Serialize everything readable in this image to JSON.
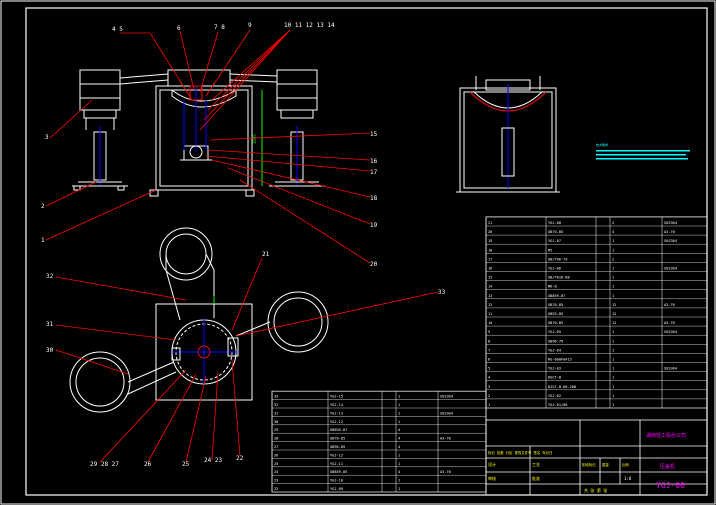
{
  "balloons": {
    "b1": "1",
    "b2": "2",
    "b3": "3",
    "b45": "4 5",
    "b6": "6",
    "b78": "7 8",
    "b9": "9",
    "b10_14": "10 11 12 13 14",
    "b15": "15",
    "b16": "16",
    "b17": "17",
    "b18": "18",
    "b19": "19",
    "b20": "20",
    "b21": "21",
    "b22": "22",
    "b2423": "24 23",
    "b25": "25",
    "b26": "26",
    "b272829": "29 28 27",
    "b30": "30",
    "b31": "31",
    "b32": "32",
    "b33": "33"
  },
  "company": "湖南轻工股份公司",
  "drawing_name": "压盖机",
  "drawing_no": "YGJ-00",
  "bom_right": [
    [
      "21",
      "YGJ-08",
      "",
      "2",
      "SUS304"
    ],
    [
      "20",
      "GB70-85",
      "",
      "4",
      "A3-70"
    ],
    [
      "19",
      "YGJ-07",
      "",
      "1",
      "SUS304"
    ],
    [
      "18",
      "M5",
      "",
      "1",
      ""
    ],
    [
      "17",
      "GB/T96-79",
      "",
      "2",
      ""
    ],
    [
      "16",
      "YGJ-06",
      "",
      "1",
      "SUS304"
    ],
    [
      "15",
      "GB/T816-88",
      "",
      "1",
      ""
    ],
    [
      "14",
      "M6-8",
      "",
      "1",
      ""
    ],
    [
      "13",
      "GB859-87",
      "",
      "1",
      ""
    ],
    [
      "12",
      "GB70-85",
      "",
      "12",
      "A3-70"
    ],
    [
      "11",
      "GB93-85",
      "",
      "12",
      ""
    ],
    [
      "10",
      "GB70-85",
      "",
      "12",
      "A3-70"
    ],
    [
      "9",
      "YGJ-05",
      "",
      "1",
      "SUS304"
    ],
    [
      "8",
      "GB96-79",
      "",
      "1",
      ""
    ],
    [
      "7",
      "YGJ-04",
      "",
      "1",
      ""
    ],
    [
      "6",
      "RG-600F0413",
      "",
      "1",
      ""
    ],
    [
      "5",
      "YGJ-03",
      "",
      "1",
      "SUS304"
    ],
    [
      "4",
      "DGCT-B",
      "",
      "1",
      ""
    ],
    [
      "3",
      "DJST-B-60-200",
      "",
      "1",
      ""
    ],
    [
      "2",
      "YGJ-02",
      "",
      "1",
      ""
    ],
    [
      "1",
      "YGJ-01/00",
      "",
      "1",
      ""
    ]
  ],
  "bom_left": [
    [
      "33",
      "YGJ-15",
      "",
      "1",
      "SUS304"
    ],
    [
      "32",
      "YGJ-14",
      "",
      "1",
      ""
    ],
    [
      "31",
      "YGJ-13",
      "",
      "1",
      "SUS304"
    ],
    [
      "30",
      "YGJ-12",
      "",
      "1",
      ""
    ],
    [
      "29",
      "GB859-87",
      "",
      "4",
      ""
    ],
    [
      "28",
      "GB70-85",
      "",
      "4",
      "A3-70"
    ],
    [
      "27",
      "GB96-85",
      "",
      "4",
      ""
    ],
    [
      "26",
      "YGJ-12",
      "",
      "1",
      ""
    ],
    [
      "25",
      "YGJ-11",
      "",
      "1",
      ""
    ],
    [
      "24",
      "GB859-85",
      "",
      "4",
      "A3-70"
    ],
    [
      "23",
      "YGJ-10",
      "",
      "1",
      ""
    ],
    [
      "22",
      "YGJ-09",
      "",
      "1",
      ""
    ]
  ],
  "title_block_labels": {
    "labels_row": "标记 处数 分区 更改文件号 签名 年月日",
    "design": "设计",
    "check": "审核",
    "process": "工艺",
    "approve": "批准",
    "stage": "阶段标记",
    "weight": "重量",
    "scale": "比例",
    "scale_val": "1:8",
    "sheets": "共 张 第 张"
  },
  "colors": {
    "background": "#000000",
    "outline": "#ffffff",
    "leader": "#ff0000",
    "center": "#0000ff",
    "label": "#ff00ff",
    "note": "#00ffff",
    "dim": "#00ff00",
    "text": "#ffff00"
  }
}
